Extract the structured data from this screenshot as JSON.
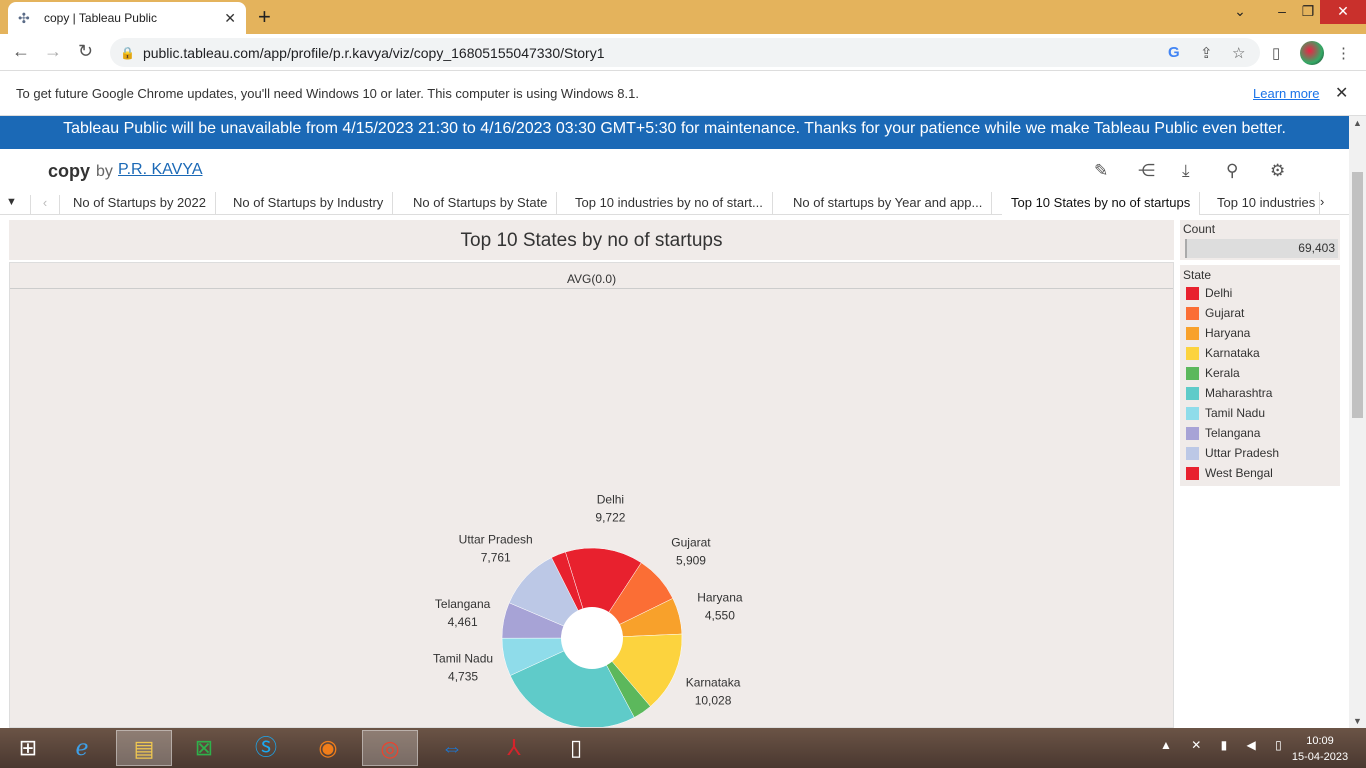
{
  "browser": {
    "tab_title": "copy | Tableau Public",
    "url": "public.tableau.com/app/profile/p.r.kavya/viz/copy_16805155047330/Story1",
    "infobar_message": "To get future Google Chrome updates, you'll need Windows 10 or later. This computer is using Windows 8.1.",
    "infobar_link": "Learn more"
  },
  "banner": "Tableau Public will be unavailable from 4/15/2023 21:30 to 4/16/2023 03:30 GMT+5:30 for maintenance. Thanks for your patience while we make Tableau Public even better.",
  "viz": {
    "name": "copy",
    "by": "by",
    "author": "P.R. KAVYA"
  },
  "story_tabs": [
    "No of Startups by 2022",
    "No of Startups by Industry",
    "No of Startups by State",
    "Top 10 industries by no of start...",
    "No of startups by Year and app...",
    "Top 10 States by no of startups",
    "Top 10 industries"
  ],
  "active_story_tab": 5,
  "chart_title": "Top 10 States by no of startups",
  "avg_header": "AVG(0.0)",
  "count_card": {
    "label": "Count",
    "value": "69,403"
  },
  "legend_title": "State",
  "chart_data": {
    "type": "pie",
    "title": "Top 10 States by no of startups",
    "categories": [
      "Delhi",
      "Gujarat",
      "Haryana",
      "Karnataka",
      "Kerala",
      "Maharashtra",
      "Tamil Nadu",
      "Telangana",
      "Uttar Pradesh",
      "West Bengal"
    ],
    "colors": [
      "#e8212e",
      "#fb6e35",
      "#f8a12b",
      "#fcd33e",
      "#5cb85c",
      "#5fcbc9",
      "#8fdcea",
      "#a7a3d6",
      "#bcc8e6",
      "#e8212e"
    ],
    "values": [
      9722,
      5909,
      4550,
      10028,
      2400,
      18000,
      4735,
      4461,
      7761,
      1837
    ],
    "data_labels": [
      {
        "name": "Delhi",
        "value": "9,722"
      },
      {
        "name": "Gujarat",
        "value": "5,909"
      },
      {
        "name": "Haryana",
        "value": "4,550"
      },
      {
        "name": "Karnataka",
        "value": "10,028"
      },
      {
        "name": "Maharashtra",
        "value": ""
      },
      {
        "name": "Tamil Nadu",
        "value": "4,735"
      },
      {
        "name": "Telangana",
        "value": "4,461"
      },
      {
        "name": "Uttar Pradesh",
        "value": "7,761"
      }
    ]
  },
  "taskbar": {
    "time": "10:09",
    "date": "15-04-2023"
  }
}
